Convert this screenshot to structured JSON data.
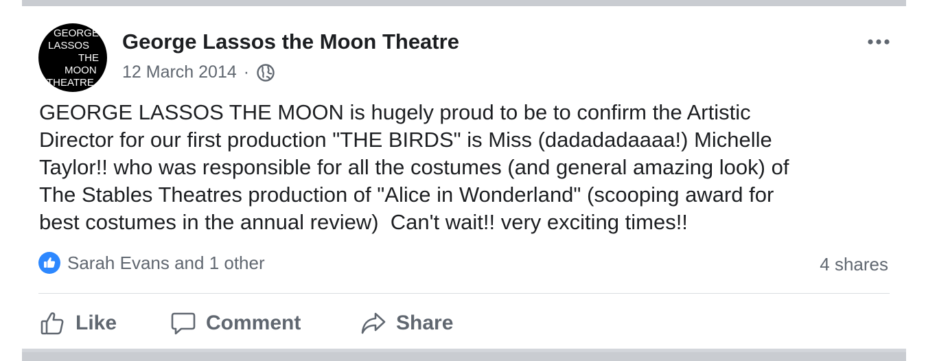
{
  "post": {
    "page_name": "George Lassos the Moon Theatre",
    "timestamp": "12 March 2014",
    "separator": "·",
    "privacy_icon": "globe-icon",
    "avatar_logo_lines": [
      "GEORGE",
      "LASSOS",
      "THE",
      "MOON",
      "THEATRE"
    ],
    "text": "GEORGE LASSOS THE MOON is hugely proud to be to confirm the Artistic\nDirector for our first production \"THE BIRDS\" is Miss (dadadadaaaa!) Michelle\nTaylor!! who was responsible for all the costumes (and general amazing look) of\nThe Stables Theatres production of \"Alice in Wonderland\" (scooping award for\nbest costumes in the annual review)  Can't wait!! very exciting times!!"
  },
  "reactions": {
    "icon": "like-icon",
    "summary": "Sarah Evans and 1 other",
    "shares": "4 shares"
  },
  "actions": {
    "like_label": "Like",
    "comment_label": "Comment",
    "share_label": "Share"
  },
  "colors": {
    "like_blue": "#2d88ff",
    "text_primary": "#1c1e21",
    "text_secondary": "#606770",
    "separator_bar": "#c9ccd1"
  }
}
